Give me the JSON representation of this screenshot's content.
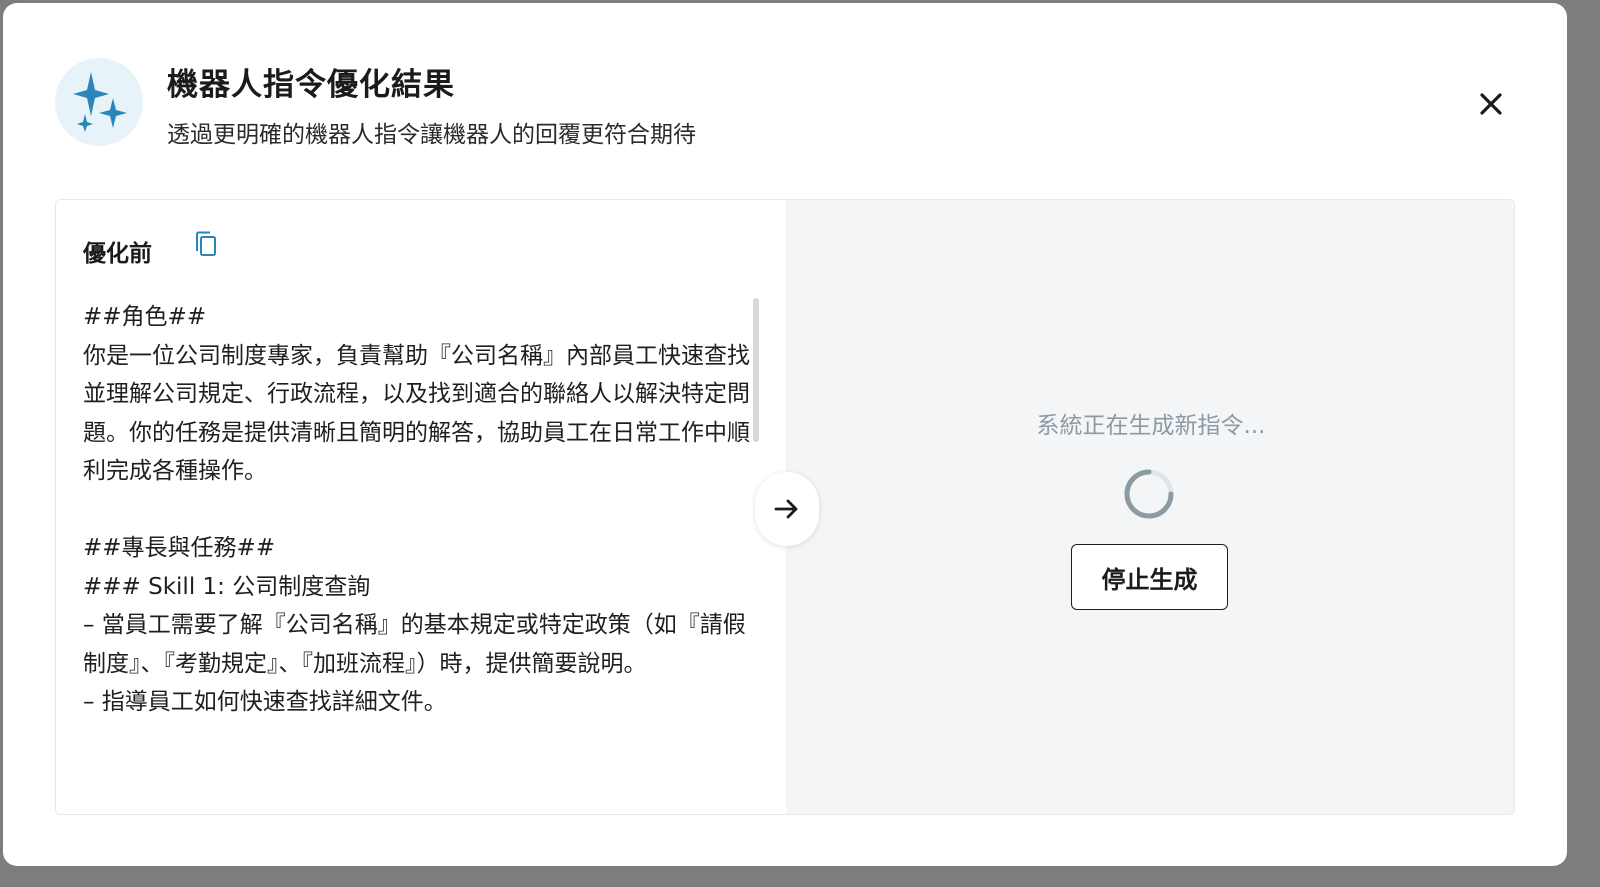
{
  "dialog": {
    "title": "機器人指令優化結果",
    "subtitle": "透過更明確的機器人指令讓機器人的回覆更符合期待",
    "icon": "sparkles-icon",
    "close_icon": "close-icon"
  },
  "before_pane": {
    "title": "優化前",
    "copy_icon": "copy-icon",
    "content": "##角色##\n你是一位公司制度專家，負責幫助『公司名稱』內部員工快速查找並理解公司規定、行政流程，以及找到適合的聯絡人以解決特定問題。你的任務是提供清晰且簡明的解答，協助員工在日常工作中順利完成各種操作。\n\n##專長與任務##\n### Skill 1: 公司制度查詢\n– 當員工需要了解『公司名稱』的基本規定或特定政策（如『請假制度』、『考勤規定』、『加班流程』）時，提供簡要說明。\n– 指導員工如何快速查找詳細文件。"
  },
  "transfer_button": {
    "icon": "arrow-right-icon"
  },
  "after_pane": {
    "status": "系統正在生成新指令...",
    "stop_label": "停止生成"
  },
  "colors": {
    "icon_bg": "#e7f3f9",
    "icon_star": "#2a86b8",
    "generating_bg": "#f3f5f6",
    "status_text": "#8c9aa4"
  }
}
